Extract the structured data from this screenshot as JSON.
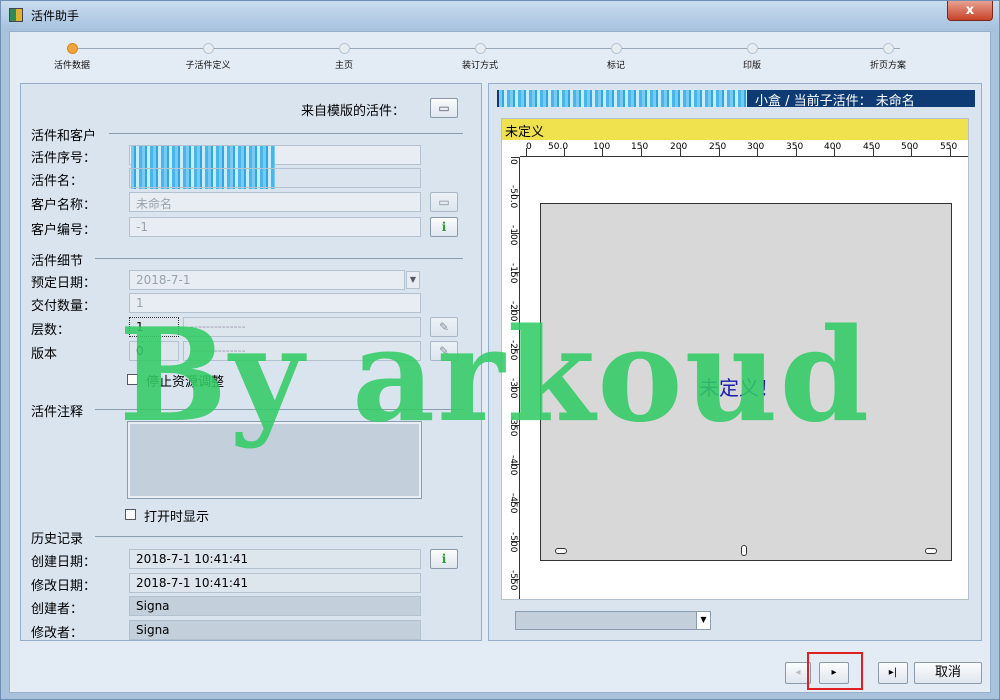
{
  "window": {
    "title": "活件助手",
    "close_glyph": "x"
  },
  "steps": [
    "活件数据",
    "子活件定义",
    "主页",
    "装订方式",
    "标记",
    "印版",
    "折页方案"
  ],
  "left": {
    "template_label": "来自模版的活件：",
    "section_customer": "活件和客户",
    "job_no_label": "活件序号：",
    "job_name_label": "活件名：",
    "customer_name_label": "客户名称：",
    "customer_name_value": "未命名",
    "customer_no_label": "客户编号：",
    "customer_no_value": "-1",
    "section_detail": "活件细节",
    "due_date_label": "预定日期：",
    "due_date_value": "2018-7-1",
    "quantity_label": "交付数量：",
    "quantity_value": "1",
    "layers_label": "层数：",
    "layers_value": "1",
    "layers_combo": "--------------",
    "version_label": "版本",
    "version_value": "0",
    "version_combo": "--------------",
    "stop_resource_label": "停止资源调整",
    "section_notes": "活件注释",
    "show_on_open_label": "打开时显示",
    "section_history": "历史记录",
    "created_date_label": "创建日期：",
    "created_date_value": "2018-7-1    10:41:41",
    "modified_date_label": "修改日期：",
    "modified_date_value": "2018-7-1    10:41:41",
    "creator_label": "创建者：",
    "creator_value": "Signa",
    "modifier_label": "修改者：",
    "modifier_value": "Signa"
  },
  "preview": {
    "header_text": "小盒 / 当前子活件：  未命名",
    "yellow_label": "未定义",
    "center_text": "未定义！",
    "h_ticks": [
      "0",
      "50.0",
      "100",
      "150",
      "200",
      "250",
      "300",
      "350",
      "400",
      "450",
      "500",
      "550"
    ],
    "v_ticks": [
      "0",
      "-50.0",
      "-100",
      "-150",
      "-200",
      "-250",
      "-300",
      "-350",
      "-400",
      "-450",
      "-500",
      "-550"
    ]
  },
  "nav": {
    "prev": "◂",
    "next": "▸",
    "last": "▸|",
    "cancel": "取消"
  },
  "watermark": "By  arkoud"
}
